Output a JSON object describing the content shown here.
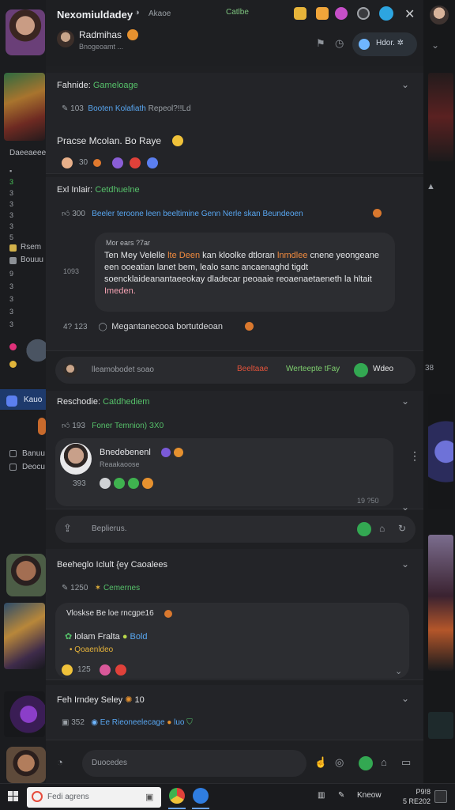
{
  "header": {
    "title": "Nexomiuldadey",
    "subtitle": "Akaoe",
    "pill": "Catlbe",
    "close": "✕",
    "user_name": "Radmihas",
    "user_status": "Bnogeoamt ...",
    "action_button": "Hdor. ✲"
  },
  "left_rail": {
    "label_1": "Daeeaeeeo",
    "digits": [
      "3",
      "3",
      "3",
      "3",
      "3",
      "5",
      "1",
      "5"
    ],
    "item_a": "Rsem",
    "item_b": "Bouuu",
    "digits_2": [
      "9",
      "3",
      "3",
      "3",
      "3"
    ],
    "item_c": "Kauo",
    "item_d": "Banuu",
    "item_e": "Deocu"
  },
  "posts": [
    {
      "title": "Fahnide:",
      "title_tag": "Gameloage",
      "meta_count": "103",
      "meta_text": "Booten Kolafiath",
      "meta_text2": "Repeol?!!Ld",
      "body": "Pracse Mcolan. Bo Raye",
      "reactions": "30"
    },
    {
      "title": "Exl Inlair:",
      "title_tag": "Cetdhuelne",
      "meta_count": "300",
      "meta_text": "Beeler teroone leen beeltimine Genn Nerle skan Beundeoen",
      "bubble_head": "Mor ears ?7ar",
      "bubble_line_a": "Ten Mey Velelle ",
      "bubble_hl": "lte Deen",
      "bubble_line_b": " kan kloolke dtloran ",
      "bubble_hl2": "lnmdlee",
      "bubble_line_c": " cnene yeongeane een ooeatian lanet bem, lealo sanc ancaenaghd tigdt soencklaideanantaeeokay dladecar peoaaie reoaenaetaeneth la hltait ",
      "bubble_end": "Imeden.",
      "side_num": "1093",
      "foot_num": "4? 123",
      "foot_text": "Megantanecooa bortutdeoan"
    }
  ],
  "compose_1": {
    "placeholder": "lleamobodet soao",
    "react_1": "Beeltaae",
    "react_2": "Werteepte tFay",
    "send_label": "Wdeo"
  },
  "post_3": {
    "title": "Reschodie:",
    "title_tag": "Catdhediem",
    "meta_count": "193",
    "meta_text": "Foner Temnion) ЗХ0",
    "card_name": "Bnedebenenl",
    "card_sub": "Reaakaoose",
    "card_count": "393",
    "timestamp": "19 ?50"
  },
  "compose_2": {
    "placeholder": "Beplierus."
  },
  "post_4": {
    "title": "Beeheglo Iclult {ey Caoalees",
    "meta_count": "1250",
    "meta_text": "Cemernes",
    "bubble_head": "Vloskse Be loe rncgpe16",
    "line_a": "lolam Fralta",
    "line_a_end": "Bold",
    "line_b": "Qoaenldeo",
    "count": "125"
  },
  "post_5": {
    "title": "Feh Irndey Seley",
    "title_end": "10",
    "meta_count": "352",
    "meta_text": "Ee Rieoneelecage",
    "meta_end": "luo"
  },
  "compose_3": {
    "placeholder": "Duocedes"
  },
  "taskbar": {
    "search_placeholder": "Fedi agrens",
    "tray_1": "Kneow",
    "clock_time": "P9!8",
    "clock_date": "5 RE202"
  },
  "colors": {
    "accent_green": "#56c16a",
    "accent_blue": "#58a6f0",
    "accent_orange": "#f08a3e",
    "panel": "#232428"
  }
}
